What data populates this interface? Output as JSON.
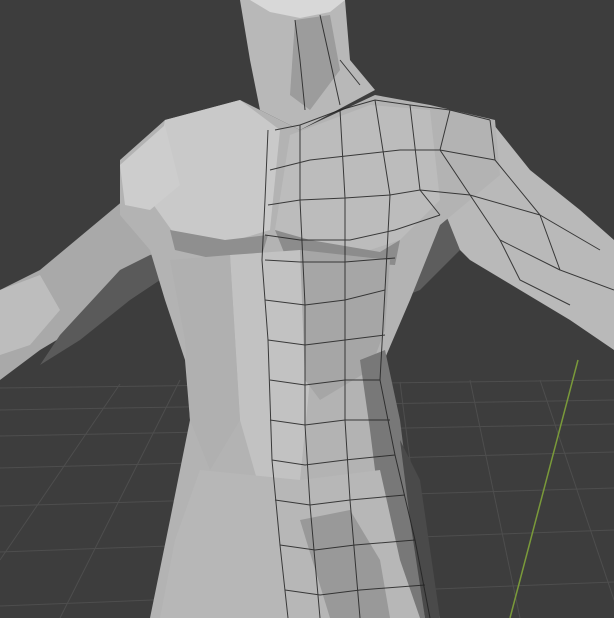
{
  "viewport": {
    "background": "#3d3d3d",
    "grid_color": "#525252",
    "y_axis_color": "#7a9a3a"
  },
  "mesh": {
    "object": "humanoid-torso",
    "display": "solid-with-wireframe-overlay",
    "base_color": "#b4b4b4",
    "light_color": "#cfcfcf",
    "shadow_color": "#6a6a6a",
    "wire_color": "#1e1e1e"
  }
}
